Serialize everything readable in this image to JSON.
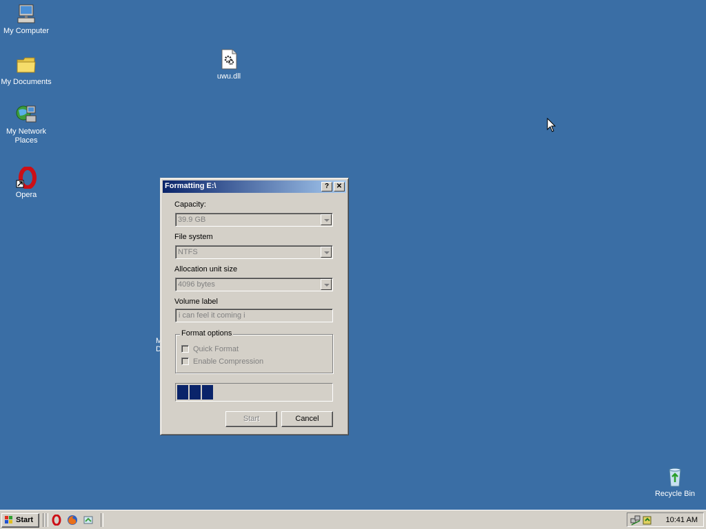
{
  "desktop": {
    "icons": [
      {
        "label": "My Computer"
      },
      {
        "label": "My Documents"
      },
      {
        "label": "My Network Places"
      },
      {
        "label": "Opera"
      },
      {
        "label": "uwu.dll"
      },
      {
        "label": "Recycle Bin"
      }
    ],
    "stray_text_line1": "M",
    "stray_text_line2": "D"
  },
  "dialog": {
    "title": "Formatting E:\\",
    "help_glyph": "?",
    "close_glyph": "✕",
    "capacity": {
      "label": "Capacity:",
      "value": "39.9 GB"
    },
    "file_system": {
      "label": "File system",
      "value": "NTFS"
    },
    "allocation": {
      "label": "Allocation unit size",
      "value": "4096 bytes"
    },
    "volume_label": {
      "label": "Volume label",
      "value": "i can feel it coming i"
    },
    "format_options": {
      "legend": "Format options",
      "quick_format": {
        "label": "Quick Format",
        "checked": false
      },
      "compression": {
        "label": "Enable Compression",
        "checked": false
      }
    },
    "progress": {
      "blocks_filled": 3,
      "fraction": 0.24
    },
    "start_label": "Start",
    "cancel_label": "Cancel"
  },
  "taskbar": {
    "start_label": "Start",
    "quicklaunch": [
      "opera-icon",
      "firefox-icon",
      "show-desktop-icon"
    ],
    "clock": "10:41 AM"
  },
  "colors": {
    "desktop": "#3a6ea5",
    "titlebar_start": "#0a246a",
    "titlebar_end": "#a6caf0",
    "progress": "#0a246a",
    "face": "#d4d0c8"
  }
}
